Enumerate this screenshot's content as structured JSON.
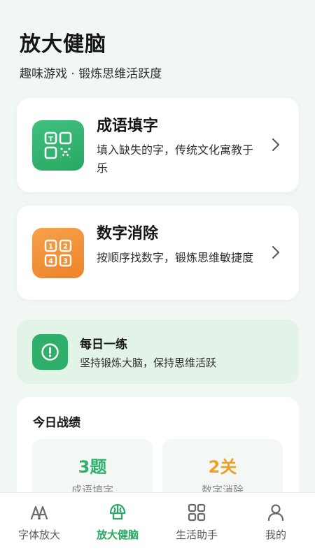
{
  "header": {
    "title": "放大健脑",
    "subtitle": "趣味游戏 · 锻炼思维活跃度"
  },
  "games": [
    {
      "title": "成语填字",
      "description": "填入缺失的字，传统文化寓教于乐",
      "icon": "idiom-grid-icon",
      "color": "#2eb06a"
    },
    {
      "title": "数字消除",
      "description": "按顺序找数字，锻炼思维敏捷度",
      "icon": "number-grid-icon",
      "color": "#f0882e"
    }
  ],
  "daily": {
    "title": "每日一练",
    "description": "坚持锻炼大脑，保持思维活跃",
    "icon": "exclamation-circle-icon"
  },
  "stats": {
    "title": "今日战绩",
    "items": [
      {
        "value": "3题",
        "label": "成语填字",
        "color": "#2eb06a"
      },
      {
        "value": "2关",
        "label": "数字消除",
        "color": "#f0a020"
      }
    ]
  },
  "tabbar": {
    "items": [
      {
        "label": "字体放大",
        "icon": "font-size-icon",
        "active": false
      },
      {
        "label": "放大健脑",
        "icon": "brain-icon",
        "active": true
      },
      {
        "label": "生活助手",
        "icon": "grid-icon",
        "active": false
      },
      {
        "label": "我的",
        "icon": "user-icon",
        "active": false
      }
    ]
  },
  "colors": {
    "accent": "#2aa964",
    "background": "#f1f7f3",
    "orange": "#f0882e"
  }
}
